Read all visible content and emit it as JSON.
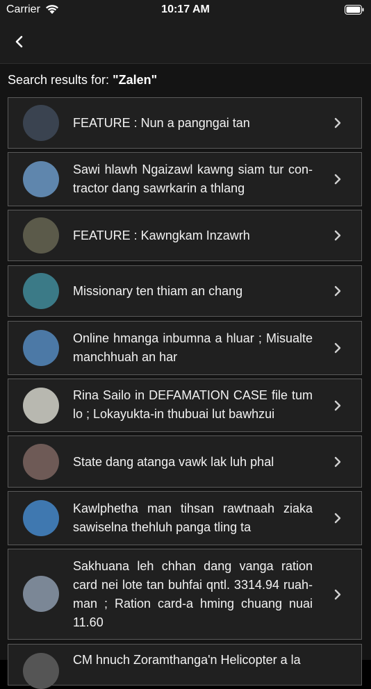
{
  "status": {
    "carrier": "Carrier",
    "time": "10:17 AM"
  },
  "nav": {
    "back_icon": "chevron-left-icon"
  },
  "search": {
    "prefix": "Search results for: ",
    "query": "\"Zalen\""
  },
  "results": [
    {
      "title": "FEATURE : Nun a pangngai tan",
      "thumb_color": "#3a4350"
    },
    {
      "title": "Sawi hlawh Ngaizawl kawng siam tur con-tractor dang sawrkarin a thlang",
      "thumb_color": "#5f86ad"
    },
    {
      "title": "FEATURE : Kawngkam Inzawrh",
      "thumb_color": "#5b5a4a"
    },
    {
      "title": "Missionary ten thiam an chang",
      "thumb_color": "#3b7a87"
    },
    {
      "title": "Online hmanga inbumna a hluar ; Misualte manchhuah an har",
      "thumb_color": "#4c79a6"
    },
    {
      "title": "Rina Sailo in DEFAMATION CASE file tum lo ; Lokayukta-in thubuai lut bawhzui",
      "thumb_color": "#b8b8b0"
    },
    {
      "title": "State dang atanga vawk lak luh phal",
      "thumb_color": "#6e5a56"
    },
    {
      "title": "Kawlphetha man tihsan rawtnaah ziaka sawiselna thehluh panga tling ta",
      "thumb_color": "#3f78b0"
    },
    {
      "title": "Sakhuana leh chhan dang vanga ration card nei lote tan buhfai qntl. 3314.94 ruah-man ; Ration card-a hming chuang nuai 11.60",
      "thumb_color": "#7b8796"
    },
    {
      "title": "CM hnuch Zoramthanga'n Helicopter a la",
      "thumb_color": "#555555"
    }
  ]
}
